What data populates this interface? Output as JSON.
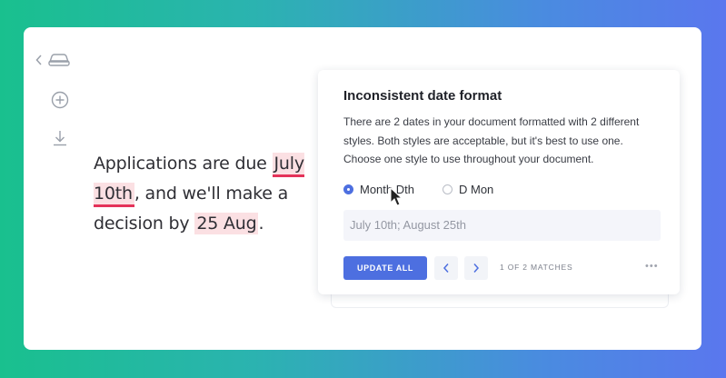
{
  "sidebar": {
    "icons": [
      "back-chevron-icon",
      "car-icon",
      "add-circle-icon",
      "download-icon"
    ]
  },
  "document": {
    "segments": [
      {
        "text": "Applications are due ",
        "style": "plain"
      },
      {
        "text": "July 10th",
        "style": "highlight-active"
      },
      {
        "text": ", and we'll make a decision by ",
        "style": "plain"
      },
      {
        "text": "25 Aug",
        "style": "highlight"
      },
      {
        "text": ".",
        "style": "plain"
      }
    ]
  },
  "panel": {
    "title": "Inconsistent date format",
    "description_lines": [
      "There are 2 dates in your document formatted with 2 different",
      "styles. Both styles are acceptable, but it's best to use one.",
      "Choose one style to use throughout your document."
    ],
    "options": [
      {
        "label": "Month Dth",
        "selected": true
      },
      {
        "label": "D Mon",
        "selected": false
      }
    ],
    "preview": "July 10th; August 25th",
    "update_label": "UPDATE ALL",
    "matches": "1 OF 2 MATCHES",
    "more": "•••"
  },
  "colors": {
    "accent": "#4d6fe0",
    "highlight": "#fbe0e3",
    "underline": "#e4335a"
  }
}
